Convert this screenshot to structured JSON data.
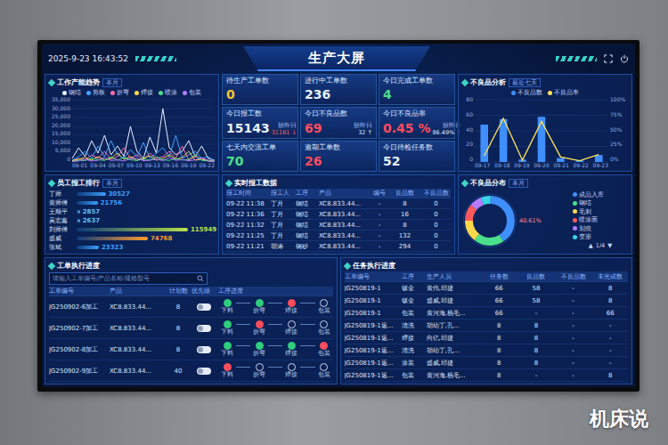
{
  "header": {
    "datetime": "2025-9-23 16:43:52",
    "title": "生产大屏"
  },
  "capacity": {
    "title": "工作产能趋势",
    "tag": "本月",
    "y_ticks": [
      "35,000",
      "30,000",
      "25,000",
      "20,000",
      "15,000",
      "10,000",
      "5,000",
      "0"
    ],
    "x_ticks": [
      "09-01",
      "09-04",
      "09-07",
      "09-10",
      "09-13",
      "09-16",
      "09-19",
      "09-22"
    ],
    "series": [
      {
        "name": "钢结",
        "color": "#e8f0ff",
        "values": [
          2000,
          8000,
          3000,
          12000,
          5000,
          15000,
          4000,
          9000,
          3000,
          20000,
          6000,
          2000,
          14000,
          5000,
          30000,
          8000,
          4000,
          6000,
          12000,
          3000,
          9000,
          2000,
          1000
        ]
      },
      {
        "name": "剪板",
        "color": "#3fa3ff",
        "values": [
          1000,
          3000,
          6000,
          2000,
          9000,
          3000,
          12000,
          4000,
          2000,
          7000,
          3000,
          11000,
          2000,
          5000,
          8000,
          3000,
          15000,
          2000,
          4000,
          6000,
          2000,
          3000,
          500
        ]
      },
      {
        "name": "折弯",
        "color": "#ff6fa8",
        "values": [
          500,
          2000,
          1000,
          4000,
          2000,
          6000,
          1500,
          3000,
          8000,
          2000,
          4000,
          1000,
          5000,
          2000,
          3000,
          6000,
          2000,
          9000,
          1000,
          3000,
          2000,
          1000,
          200
        ]
      },
      {
        "name": "焊接",
        "color": "#ffd84a",
        "values": [
          800,
          1500,
          2500,
          1000,
          3000,
          1200,
          2000,
          5000,
          1500,
          3000,
          1000,
          2000,
          3500,
          1000,
          2000,
          4000,
          1500,
          2500,
          6000,
          1000,
          1500,
          800,
          300
        ]
      },
      {
        "name": "喷涂",
        "color": "#4be08a",
        "values": [
          300,
          1000,
          800,
          2000,
          1200,
          900,
          3000,
          1000,
          2500,
          1200,
          800,
          1800,
          1000,
          3000,
          1200,
          900,
          2000,
          1100,
          1500,
          4000,
          900,
          600,
          200
        ]
      },
      {
        "name": "包装",
        "color": "#b57cff",
        "values": [
          200,
          600,
          1500,
          500,
          1000,
          2500,
          800,
          1200,
          600,
          1800,
          2200,
          700,
          1000,
          1500,
          800,
          2600,
          900,
          1300,
          700,
          1200,
          2500,
          500,
          100
        ]
      }
    ]
  },
  "kpis": [
    {
      "label": "待生产工单数",
      "value": "0",
      "color": "#ffc531"
    },
    {
      "label": "进行中工单数",
      "value": "236",
      "color": "#e8f2ff"
    },
    {
      "label": "今日完成工单数",
      "value": "4",
      "color": "#4be08a"
    },
    {
      "label": "今日报工数",
      "value": "15143",
      "color": "#e8f2ff",
      "delta": {
        "label": "较昨日",
        "value": "31161",
        "arrow": "↓",
        "color": "#ff5a5a"
      }
    },
    {
      "label": "今日不良品数",
      "value": "69",
      "color": "#ff4d5e",
      "delta": {
        "label": "较昨日",
        "value": "32",
        "arrow": "↑",
        "color": "#dbe8ff"
      }
    },
    {
      "label": "今日不良品率",
      "value": "0.45 %",
      "color": "#ff4d5e",
      "delta": {
        "label": "较昨日",
        "value": "86.49%",
        "arrow": "↑",
        "color": "#dbe8ff"
      }
    },
    {
      "label": "七天内交流工单",
      "value": "70",
      "color": "#4be08a"
    },
    {
      "label": "逾期工单数",
      "value": "26",
      "color": "#ff4d5e"
    },
    {
      "label": "今日待检任务数",
      "value": "52",
      "color": "#e8f2ff"
    }
  ],
  "defects": {
    "title": "不良品分析",
    "tag": "最近七天",
    "legend": [
      {
        "name": "不良品数",
        "color": "#3f8fff"
      },
      {
        "name": "不良品率",
        "color": "#ffe45c"
      }
    ],
    "y_left": [
      "80",
      "60",
      "40",
      "20",
      "0"
    ],
    "y_right": [
      "100%",
      "75%",
      "50%",
      "25%",
      "0%"
    ],
    "x_ticks": [
      "09-17",
      "09-18",
      "09-19",
      "09-20",
      "09-21",
      "09-22",
      "09-23"
    ],
    "counts": [
      48,
      55,
      3,
      58,
      5,
      2,
      9
    ],
    "rates": [
      10,
      70,
      3,
      65,
      8,
      2,
      12
    ]
  },
  "ranking": {
    "title": "员工报工排行",
    "tag": "本月",
    "items": [
      {
        "name": "丁师",
        "value": "30527",
        "level": 0.26,
        "color": "#3aa0ff"
      },
      {
        "name": "黄师傅",
        "value": "21756",
        "level": 0.19,
        "color": "#3aa0ff"
      },
      {
        "name": "王顺平",
        "value": "2857",
        "level": 0.03,
        "color": "#5fc0ff"
      },
      {
        "name": "吴宏鑫",
        "value": "2637",
        "level": 0.03,
        "color": "#5fc0ff"
      },
      {
        "name": "刘师傅",
        "value": "115949",
        "level": 1.0,
        "color": "#b8e04a"
      },
      {
        "name": "盛威",
        "value": "74768",
        "level": 0.64,
        "color": "#ff9a2e"
      },
      {
        "name": "张斌",
        "value": "23323",
        "level": 0.2,
        "color": "#3aa0ff"
      }
    ]
  },
  "realtime": {
    "title": "实时报工数据",
    "columns": [
      "报工时间",
      "报工人",
      "工序",
      "产品",
      "编号",
      "良品数",
      "不良品数"
    ],
    "rows": [
      [
        "09-22 11:38",
        "丁月",
        "钢结",
        "XC8.833.44...",
        "-",
        "8",
        "0"
      ],
      [
        "09-22 11:36",
        "丁月",
        "钢结",
        "XC8.833.44...",
        "-",
        "16",
        "0"
      ],
      [
        "09-22 11:32",
        "丁月",
        "钢结",
        "XC8.833.44...",
        "-",
        "8",
        "0"
      ],
      [
        "09-22 11:25",
        "丁月",
        "钢结",
        "XC8.833.44...",
        "-",
        "132",
        "0"
      ],
      [
        "09-22 11:21",
        "胡涛",
        "钢砂",
        "XC8.833.44...",
        "-",
        "294",
        "0"
      ]
    ]
  },
  "distribution": {
    "title": "不良品分布",
    "tag": "本月",
    "callout": "40.61%",
    "items": [
      {
        "name": "成品入库",
        "share": 40.61,
        "color": "#3f8fff"
      },
      {
        "name": "钢结",
        "share": 20,
        "color": "#4be08a"
      },
      {
        "name": "毛刺",
        "share": 14,
        "color": "#ffd84a"
      },
      {
        "name": "喷涂面",
        "share": 11,
        "color": "#ff5a5a"
      },
      {
        "name": "划痕",
        "share": 8,
        "color": "#b57cff"
      },
      {
        "name": "变形",
        "share": 6.39,
        "color": "#36d6e7"
      }
    ],
    "pager": {
      "prev": "▲",
      "page": "1/4",
      "next": "▼"
    }
  },
  "orders": {
    "title": "工单执行进度",
    "search_placeholder": "请输入工单编号/产品名称/规格型号",
    "columns": [
      "工单编号",
      "产品",
      "计划数",
      "优先级",
      "工序进度"
    ],
    "rows": [
      {
        "id": "JG250902-6加工",
        "product": "XC8.833.44...",
        "plan": "8",
        "priority_on": false,
        "steps": [
          {
            "name": "下料",
            "done": true,
            "current": false
          },
          {
            "name": "折弯",
            "done": true,
            "current": false
          },
          {
            "name": "焊接",
            "done": false,
            "current": true
          },
          {
            "name": "包装",
            "done": false,
            "current": false
          }
        ]
      },
      {
        "id": "JG250902-7加工",
        "product": "XC8.833.44...",
        "plan": "8",
        "priority_on": false,
        "steps": [
          {
            "name": "下料",
            "done": true,
            "current": false
          },
          {
            "name": "折弯",
            "done": false,
            "current": true
          },
          {
            "name": "焊接",
            "done": false,
            "current": false
          },
          {
            "name": "包装",
            "done": false,
            "current": false
          }
        ]
      },
      {
        "id": "JG250902-8加工",
        "product": "XC8.833.44...",
        "plan": "8",
        "priority_on": false,
        "steps": [
          {
            "name": "下料",
            "done": true,
            "current": false
          },
          {
            "name": "折弯",
            "done": true,
            "current": false
          },
          {
            "name": "焊接",
            "done": true,
            "current": false
          },
          {
            "name": "包装",
            "done": false,
            "current": true
          }
        ]
      },
      {
        "id": "JG250902-9加工",
        "product": "XC8.833.44...",
        "plan": "40",
        "priority_on": false,
        "steps": [
          {
            "name": "下料",
            "done": false,
            "current": true
          },
          {
            "name": "折弯",
            "done": false,
            "current": false
          },
          {
            "name": "焊接",
            "done": false,
            "current": false
          },
          {
            "name": "包装",
            "done": false,
            "current": false
          }
        ]
      }
    ]
  },
  "tasks": {
    "title": "任务执行进度",
    "columns": [
      "工单编号",
      "工序",
      "生产人员",
      "任务数",
      "良品数",
      "不良品数",
      "未完成数"
    ],
    "rows": [
      [
        "JG250819-1",
        "钣金",
        "黄伟,邱捷",
        "66",
        "58",
        "-",
        "8"
      ],
      [
        "JG250819-1",
        "钣金",
        "盛威,邱捷",
        "66",
        "58",
        "-",
        "8"
      ],
      [
        "JG250819-1",
        "包装",
        "黄河海,杨毛...",
        "66",
        "-",
        "-",
        "66"
      ],
      [
        "JG250819-1返...",
        "清洗",
        "胡幼丁,孔...",
        "8",
        "8",
        "-",
        "-"
      ],
      [
        "JG250819-1返...",
        "焊接",
        "向亿,邱捷",
        "8",
        "8",
        "-",
        "-"
      ],
      [
        "JG250819-1返...",
        "清洗",
        "胡幼丁,孔...",
        "8",
        "8",
        "-",
        "-"
      ],
      [
        "JG250819-1返...",
        "涂装",
        "盛威,邱捷",
        "8",
        "8",
        "-",
        "-"
      ],
      [
        "JG250819-1返...",
        "包装",
        "黄河海,杨毛...",
        "8",
        "-",
        "-",
        "8"
      ]
    ]
  },
  "watermark": "机床说"
}
